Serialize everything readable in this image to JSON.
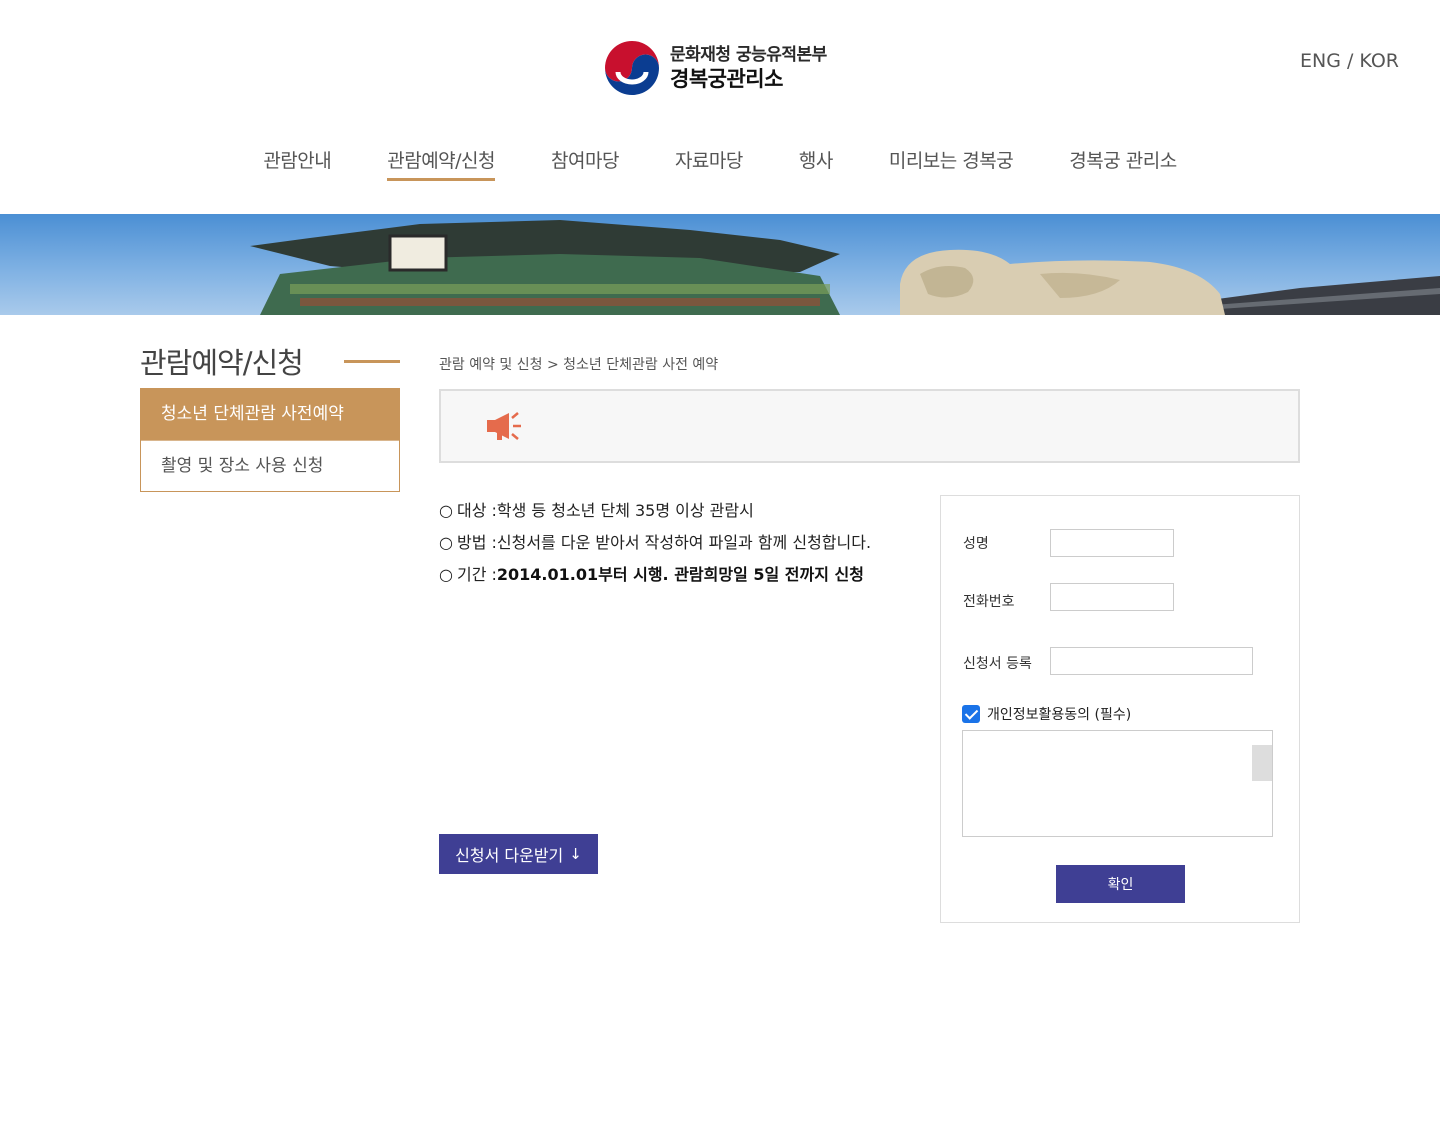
{
  "header": {
    "logo_top": "문화재청 궁능유적본부",
    "logo_bottom": "경복궁관리소",
    "lang_eng": "ENG",
    "lang_sep": " / ",
    "lang_kor": "KOR"
  },
  "nav": {
    "items": [
      {
        "label": "관람안내"
      },
      {
        "label": "관람예약/신청"
      },
      {
        "label": "참여마당"
      },
      {
        "label": "자료마당"
      },
      {
        "label": "행사"
      },
      {
        "label": "미리보는 경복궁"
      },
      {
        "label": "경복궁 관리소"
      }
    ],
    "active_index": 1
  },
  "sidebar": {
    "title": "관람예약/신청",
    "items": [
      {
        "label": "청소년 단체관람 사전예약",
        "active": true
      },
      {
        "label": "촬영 및 장소 사용 신청",
        "active": false
      }
    ]
  },
  "breadcrumb": "관람 예약 및 신청 > 청소년 단체관람 사전 예약",
  "notice": {
    "icon": "megaphone-icon",
    "text": ""
  },
  "info": [
    {
      "bullet": "○",
      "label": "대상 : ",
      "value": "학생 등 청소년 단체 35명 이상 관람시"
    },
    {
      "bullet": "○",
      "label": "방법 : ",
      "value": "신청서를 다운 받아서 작성하여 파일과 함께 신청합니다."
    },
    {
      "bullet": "○",
      "label": "기간 : ",
      "value": "2014.01.01부터 시행. 관람희망일 5일 전까지 신청"
    }
  ],
  "download": {
    "label": "신청서 다운받기",
    "arrow": "↓"
  },
  "form": {
    "name_label": "성명",
    "phone_label": "전화번호",
    "file_label": "신청서 등록",
    "name_value": "",
    "phone_value": "",
    "file_value": "",
    "agree_label": "개인정보활용동의 (필수)",
    "agree_checked": true,
    "confirm_label": "확인"
  },
  "colors": {
    "accent": "#c8955a",
    "button": "#3f3f94",
    "checkbox": "#1a73e8",
    "megaphone": "#e56b4c"
  }
}
